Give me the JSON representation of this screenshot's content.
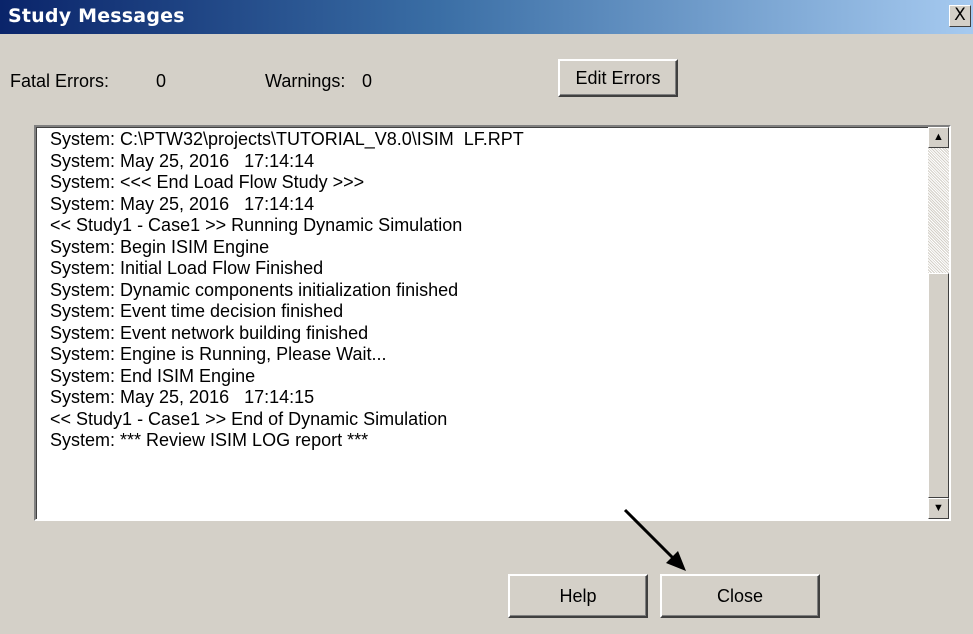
{
  "window": {
    "title": "Study Messages",
    "close_glyph": "X"
  },
  "summary": {
    "fatal_errors_label": "Fatal Errors:",
    "fatal_errors_value": "0",
    "warnings_label": "Warnings:",
    "warnings_value": "0"
  },
  "buttons": {
    "edit_errors": "Edit Errors",
    "help": "Help",
    "close": "Close"
  },
  "messages": [
    "System: C:\\PTW32\\projects\\TUTORIAL_V8.0\\ISIM  LF.RPT",
    "System: May 25, 2016   17:14:14",
    "System: <<< End Load Flow Study >>>",
    "System: May 25, 2016   17:14:14",
    "<< Study1 - Case1 >> Running Dynamic Simulation",
    "System: Begin ISIM Engine",
    "System: Initial Load Flow Finished",
    "System: Dynamic components initialization finished",
    "System: Event time decision finished",
    "System: Event network building finished",
    "System: Engine is Running, Please Wait...",
    "System: End ISIM Engine",
    "System: May 25, 2016   17:14:15",
    "<< Study1 - Case1 >> End of Dynamic Simulation",
    "System: *** Review ISIM LOG report ***"
  ],
  "scrollbar": {
    "up_glyph": "▲",
    "down_glyph": "▼"
  },
  "annotation": {
    "arrow_color": "#000000"
  }
}
